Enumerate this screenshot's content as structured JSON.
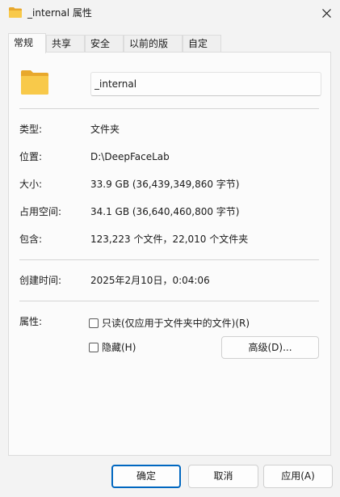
{
  "window": {
    "title": "_internal 属性",
    "close_icon": "close-icon"
  },
  "tabs": [
    {
      "label": "常规",
      "active": true
    },
    {
      "label": "共享",
      "active": false
    },
    {
      "label": "安全",
      "active": false
    },
    {
      "label": "以前的版本",
      "active": false
    },
    {
      "label": "自定义",
      "active": false
    }
  ],
  "general": {
    "folder_icon": "folder-icon",
    "name_value": "_internal",
    "rows": [
      {
        "label": "类型:",
        "value": "文件夹"
      },
      {
        "label": "位置:",
        "value": "D:\\DeepFaceLab"
      },
      {
        "label": "大小:",
        "value": "33.9 GB (36,439,349,860 字节)"
      },
      {
        "label": "占用空间:",
        "value": "34.1 GB (36,640,460,800 字节)"
      },
      {
        "label": "包含:",
        "value": "123,223 个文件，22,010 个文件夹"
      }
    ],
    "created": {
      "label": "创建时间:",
      "value": "2025年2月10日，0:04:06"
    },
    "attributes": {
      "label": "属性:",
      "readonly_label": "只读(仅应用于文件夹中的文件)(R)",
      "readonly_checked": false,
      "hidden_label": "隐藏(H)",
      "hidden_checked": false,
      "advanced_label": "高级(D)..."
    }
  },
  "footer": {
    "ok_label": "确定",
    "cancel_label": "取消",
    "apply_label": "应用(A)"
  },
  "colors": {
    "accent": "#0067c0",
    "folder_body": "#f8c94a",
    "folder_back": "#e8a82c"
  }
}
